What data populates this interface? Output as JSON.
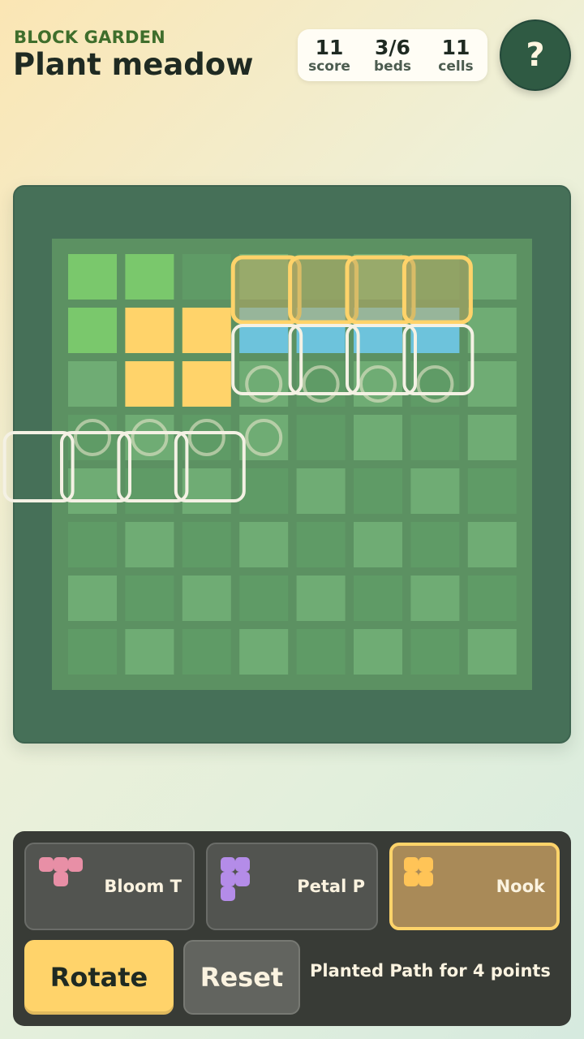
{
  "header": {
    "brand": "BLOCK GARDEN",
    "title": "Plant meadow"
  },
  "stats": [
    {
      "value": "11",
      "label": "score"
    },
    {
      "value": "3/6",
      "label": "beds"
    },
    {
      "value": "11",
      "label": "cells"
    }
  ],
  "help": {
    "label": "?"
  },
  "board": {
    "rows": 8,
    "cols": 8,
    "colors": {
      "light": "#6fac74",
      "dark": "#5f9b66",
      "grass": "#7ac86c",
      "sun": "#ffd36a",
      "water": "#6dc3dc"
    },
    "grid": [
      [
        "grass",
        "grass",
        "dark",
        "light",
        "dark",
        "light",
        "dark",
        "light"
      ],
      [
        "grass",
        "sun",
        "sun",
        "water",
        "water",
        "water",
        "water",
        "light"
      ],
      [
        "light",
        "sun",
        "sun",
        "light",
        "dark",
        "light",
        "dark",
        "light"
      ],
      [
        "dark",
        "light",
        "dark",
        "light",
        "dark",
        "light",
        "dark",
        "light"
      ],
      [
        "light",
        "dark",
        "light",
        "dark",
        "light",
        "dark",
        "light",
        "dark"
      ],
      [
        "dark",
        "light",
        "dark",
        "light",
        "dark",
        "light",
        "dark",
        "light"
      ],
      [
        "light",
        "dark",
        "light",
        "dark",
        "light",
        "dark",
        "light",
        "dark"
      ],
      [
        "dark",
        "light",
        "dark",
        "light",
        "dark",
        "light",
        "dark",
        "light"
      ]
    ],
    "highlight_cells": [
      [
        0,
        3
      ],
      [
        0,
        4
      ],
      [
        0,
        5
      ],
      [
        0,
        6
      ]
    ],
    "outline_cells": [
      [
        1,
        3
      ],
      [
        1,
        4
      ],
      [
        1,
        5
      ],
      [
        1,
        6
      ],
      [
        3,
        -1
      ],
      [
        3,
        0
      ],
      [
        3,
        1
      ],
      [
        3,
        2
      ]
    ],
    "circle_cells": [
      [
        2,
        3
      ],
      [
        2,
        4
      ],
      [
        2,
        5
      ],
      [
        2,
        6
      ],
      [
        3,
        0
      ],
      [
        3,
        1
      ],
      [
        3,
        2
      ],
      [
        3,
        3
      ]
    ],
    "highlight_color": "#ffd36a"
  },
  "pieces": [
    {
      "name": "Bloom T",
      "color": "#e88fa6",
      "selected": false
    },
    {
      "name": "Petal P",
      "color": "#b48ce8",
      "selected": false
    },
    {
      "name": "Nook",
      "color": "#ffc457",
      "selected": true
    }
  ],
  "buttons": {
    "rotate": "Rotate",
    "reset": "Reset"
  },
  "status": "Planted Path for 4 points"
}
